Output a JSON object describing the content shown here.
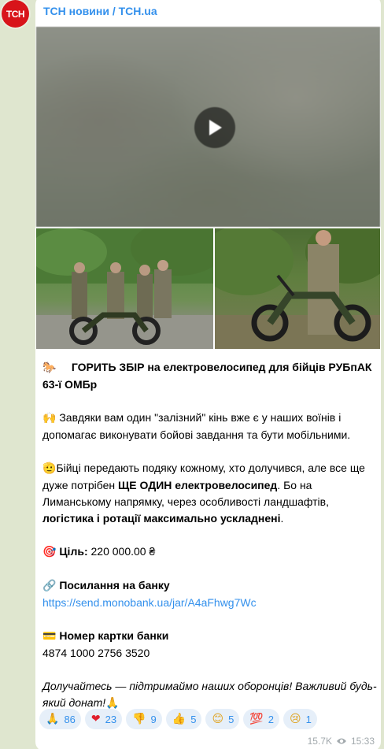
{
  "channel": {
    "avatar_text": "ТСН",
    "name": "ТСН новини / TCH.ua"
  },
  "post": {
    "title_emoji": "🐎",
    "title": "ГОРИТЬ ЗБІР на електровелосипед для бійців РУБпАК 63-ї ОМБр",
    "para1_emoji": "🙌",
    "para1": "Завдяки вам один \"залізний\" кінь вже є у наших воїнів і допомагає виконувати бойові завдання та бути мобільними.",
    "para2_emoji": "🫡",
    "para2_a": "Бійці передають подяку кожному, хто долучився, але все ще дуже потрібен ",
    "para2_b": "ЩЕ ОДИН електровелосипед",
    "para2_c": ". Бо на Лиманському напрямку, через особливості ландшафтів, ",
    "para2_d": "логістика і ротації максимально ускладнені",
    "para2_e": ".",
    "goal_emoji": "🎯",
    "goal_label": "Ціль:",
    "goal_value": "220 000.00 ₴",
    "link_emoji": "🔗",
    "link_label": "Посилання на банку",
    "link_url": "https://send.monobank.ua/jar/A4aFhwg7Wc",
    "card_emoji": "💳",
    "card_label": "Номер картки банки",
    "card_number": "4874 1000 2756 3520",
    "closing": "Долучайтесь — підтримаймо наших оборонців! Важливий будь-який донат!",
    "closing_emoji": "🙏"
  },
  "reactions": [
    {
      "icon": "🙏",
      "count": "86"
    },
    {
      "icon": "❤",
      "count": "23"
    },
    {
      "icon": "👎",
      "count": "9"
    },
    {
      "icon": "👍",
      "count": "5"
    },
    {
      "icon": "😊",
      "count": "5"
    },
    {
      "icon": "💯",
      "count": "2"
    },
    {
      "icon": "😢",
      "count": "1"
    }
  ],
  "meta": {
    "views": "15.7K",
    "time": "15:33"
  }
}
